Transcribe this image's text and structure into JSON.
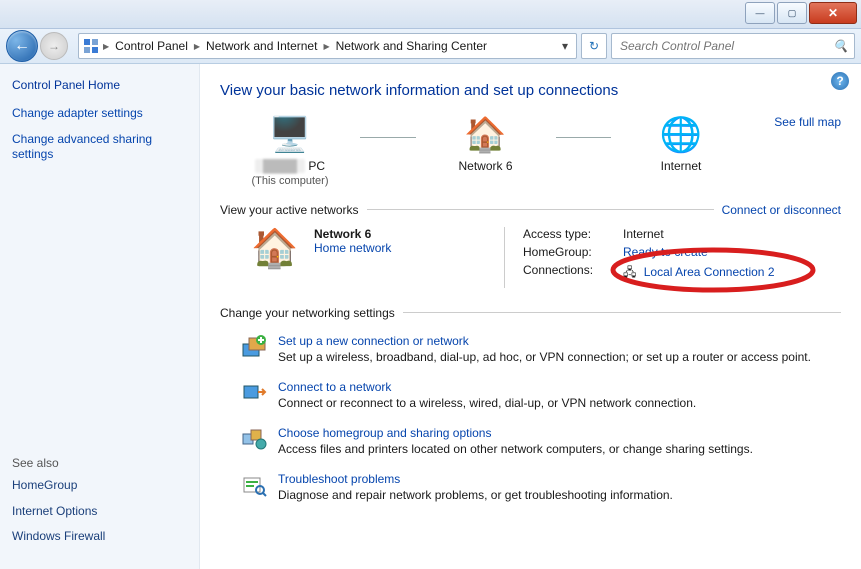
{
  "breadcrumbs": [
    "Control Panel",
    "Network and Internet",
    "Network and Sharing Center"
  ],
  "search_placeholder": "Search Control Panel",
  "sidebar": {
    "home": "Control Panel Home",
    "links": [
      "Change adapter settings",
      "Change advanced sharing settings"
    ],
    "see_also_label": "See also",
    "see_also": [
      "HomeGroup",
      "Internet Options",
      "Windows Firewall"
    ]
  },
  "title": "View your basic network information and set up connections",
  "see_full_map": "See full map",
  "map": {
    "pc_name": "PC",
    "pc_sub": "(This computer)",
    "network_name": "Network  6",
    "internet": "Internet"
  },
  "active_section": "View your active networks",
  "connect_link": "Connect or disconnect",
  "active": {
    "name": "Network  6",
    "type": "Home network",
    "access_lbl": "Access type:",
    "access_val": "Internet",
    "hg_lbl": "HomeGroup:",
    "hg_val": "Ready to create",
    "conn_lbl": "Connections:",
    "conn_val": "Local Area Connection 2"
  },
  "change_section": "Change your networking settings",
  "tasks": [
    {
      "title": "Set up a new connection or network",
      "desc": "Set up a wireless, broadband, dial-up, ad hoc, or VPN connection; or set up a router or access point."
    },
    {
      "title": "Connect to a network",
      "desc": "Connect or reconnect to a wireless, wired, dial-up, or VPN network connection."
    },
    {
      "title": "Choose homegroup and sharing options",
      "desc": "Access files and printers located on other network computers, or change sharing settings."
    },
    {
      "title": "Troubleshoot problems",
      "desc": "Diagnose and repair network problems, or get troubleshooting information."
    }
  ]
}
